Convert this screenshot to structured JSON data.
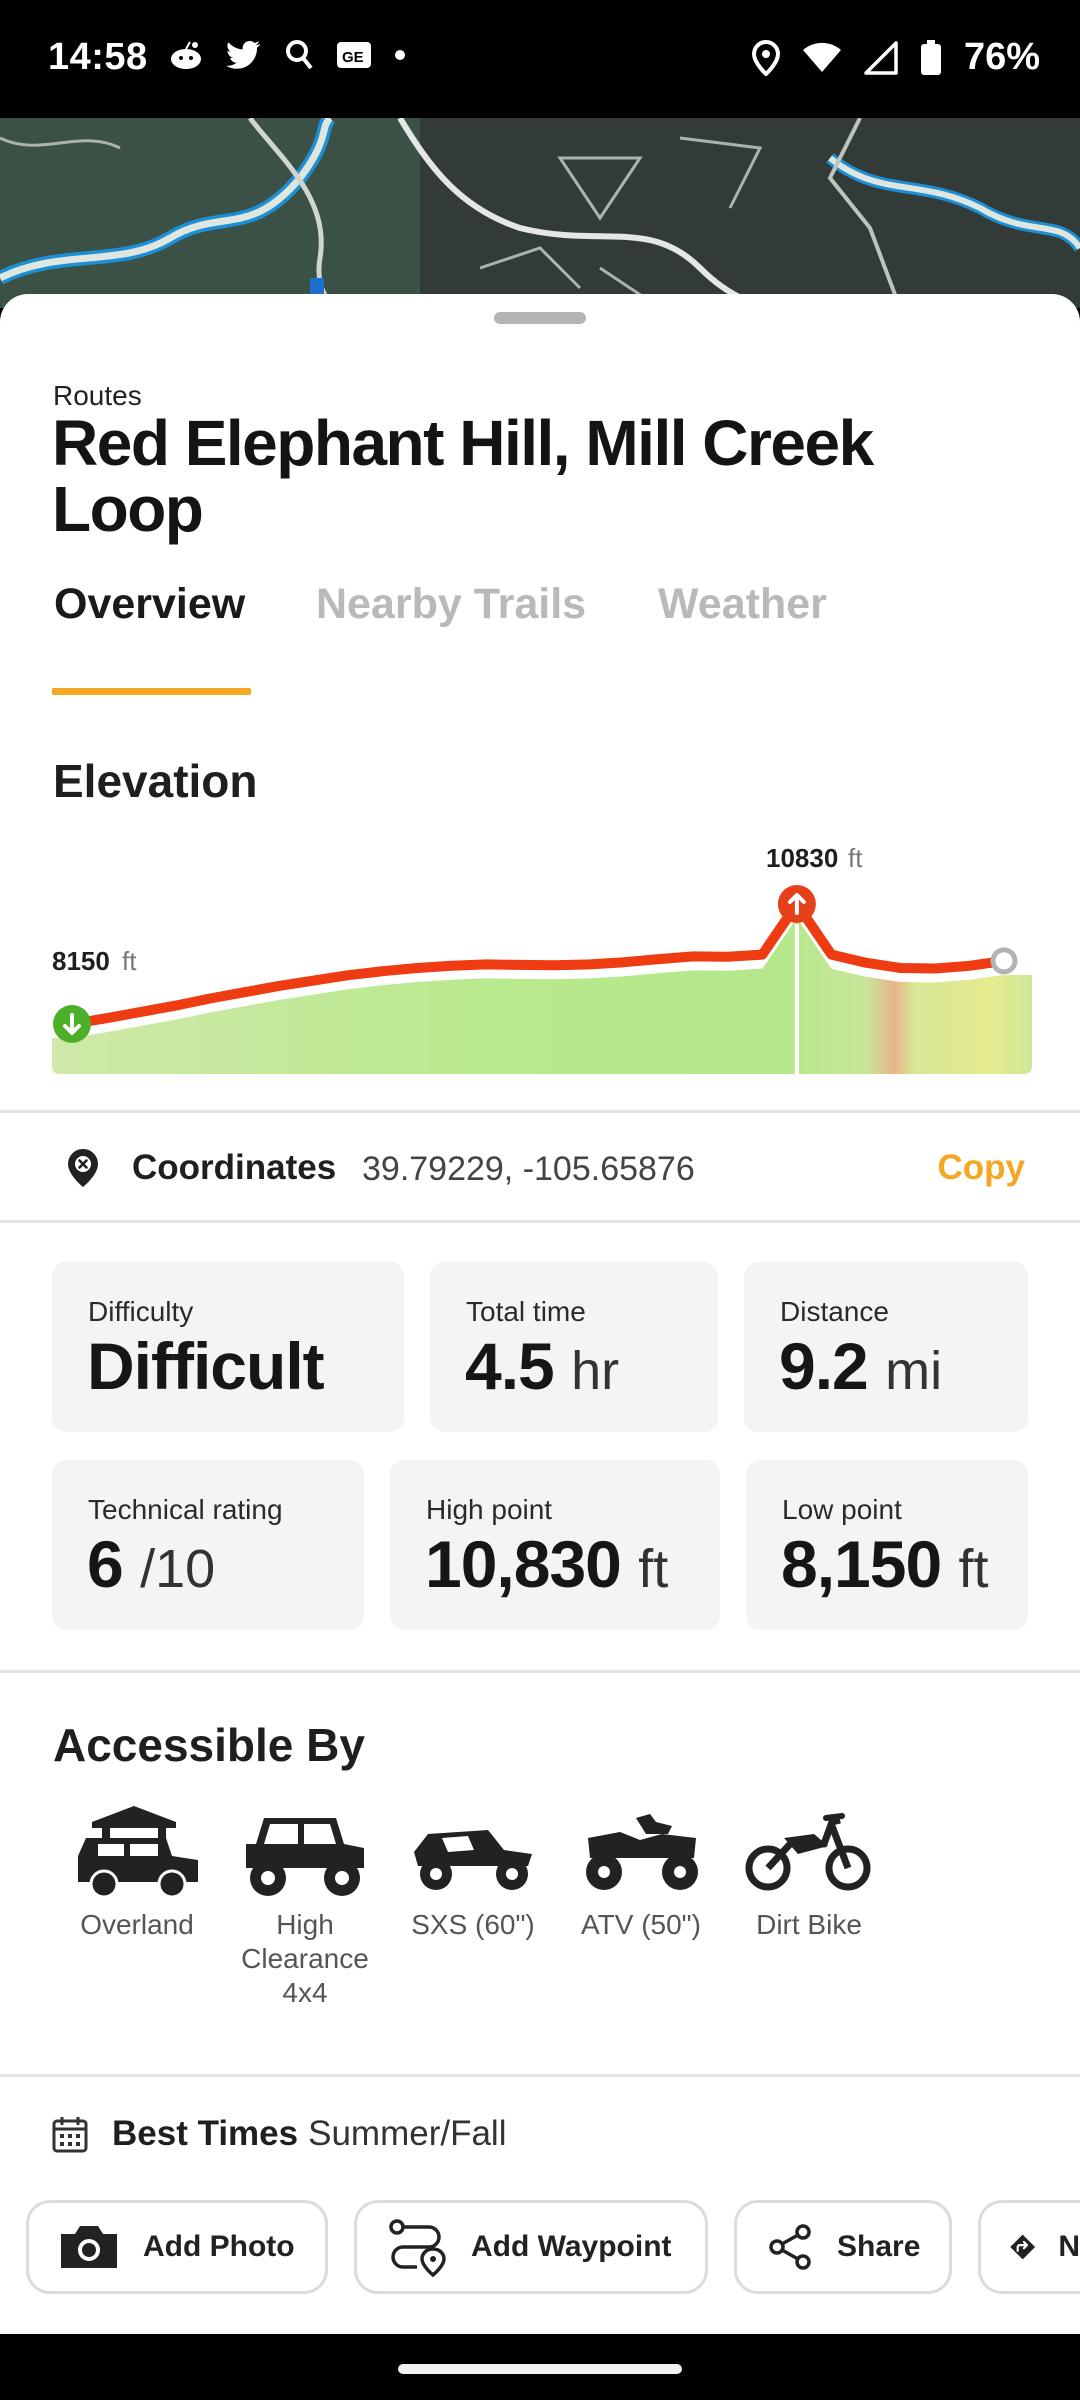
{
  "status_bar": {
    "time": "14:58",
    "battery": "76%",
    "notification_icons": [
      "reddit-icon",
      "twitter-icon",
      "search-notification-icon",
      "news-icon",
      "dot-icon"
    ],
    "system_icons": [
      "location-icon",
      "wifi-icon",
      "signal-icon",
      "battery-icon"
    ]
  },
  "route": {
    "eyebrow": "Routes",
    "title": "Red Elephant Hill, Mill Creek Loop"
  },
  "tabs": [
    {
      "label": "Overview",
      "active": true
    },
    {
      "label": "Nearby Trails",
      "active": false
    },
    {
      "label": "Weather",
      "active": false
    }
  ],
  "elevation": {
    "heading": "Elevation",
    "start_value": "8150",
    "start_unit": "ft",
    "peak_value": "10830",
    "peak_unit": "ft",
    "profile_ft": [
      8150,
      8280,
      8420,
      8560,
      8720,
      8860,
      9000,
      9120,
      9240,
      9330,
      9400,
      9450,
      9480,
      9470,
      9460,
      9480,
      9530,
      9600,
      9660,
      9650,
      9700,
      10830,
      9700,
      9520,
      9400,
      9390,
      9450,
      9560
    ]
  },
  "coordinates": {
    "label": "Coordinates",
    "value": "39.79229, -105.65876",
    "copy_label": "Copy"
  },
  "stats": {
    "difficulty": {
      "label": "Difficulty",
      "value": "Difficult"
    },
    "total_time": {
      "label": "Total time",
      "value": "4.5",
      "unit": "hr"
    },
    "distance": {
      "label": "Distance",
      "value": "9.2",
      "unit": "mi"
    },
    "technical_rating": {
      "label": "Technical rating",
      "value": "6",
      "unit": "/10"
    },
    "high_point": {
      "label": "High point",
      "value": "10,830",
      "unit": "ft"
    },
    "low_point": {
      "label": "Low point",
      "value": "8,150",
      "unit": "ft"
    }
  },
  "accessible_by": {
    "heading": "Accessible By",
    "vehicles": [
      {
        "label": "Overland",
        "icon": "overland-icon"
      },
      {
        "label": "High Clearance 4x4",
        "icon": "jeep-icon"
      },
      {
        "label": "SXS (60\")",
        "icon": "sxs-icon"
      },
      {
        "label": "ATV (50\")",
        "icon": "atv-icon"
      },
      {
        "label": "Dirt Bike",
        "icon": "dirt-bike-icon"
      }
    ]
  },
  "best_times": {
    "label": "Best Times",
    "value": "Summer/Fall"
  },
  "actions": [
    {
      "label": "Add Photo",
      "icon": "camera-icon"
    },
    {
      "label": "Add Waypoint",
      "icon": "waypoint-icon"
    },
    {
      "label": "Share",
      "icon": "share-icon"
    },
    {
      "label": "N",
      "icon": "navigate-icon"
    }
  ],
  "colors": {
    "accent": "#f5a623",
    "route_line": "#ef3b12",
    "profile_fill": "#b6e98c",
    "start_marker": "#4caf28",
    "peak_marker": "#e5401a"
  }
}
